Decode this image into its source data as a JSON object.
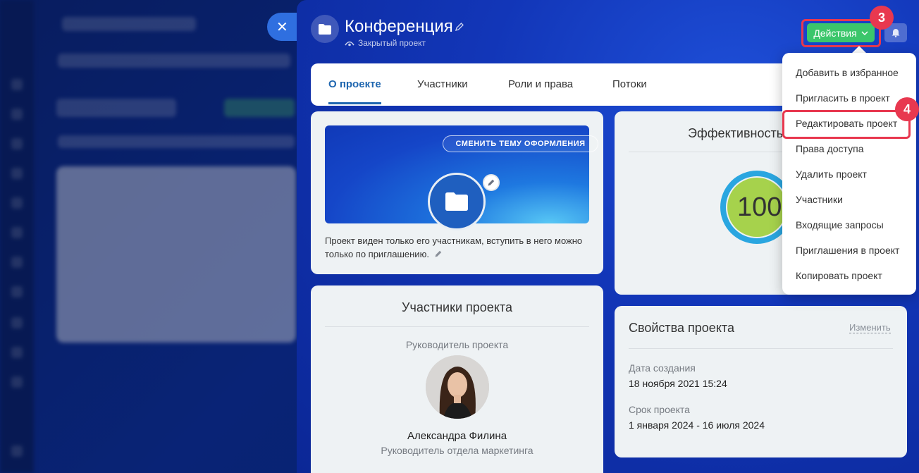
{
  "header": {
    "title": "Конференция",
    "subtitle": "Закрытый проект",
    "actions_label": "Действия",
    "close_symbol": "✕"
  },
  "tabs": [
    {
      "label": "О проекте",
      "active": true
    },
    {
      "label": "Участники",
      "active": false
    },
    {
      "label": "Роли и права",
      "active": false
    },
    {
      "label": "Потоки",
      "active": false
    }
  ],
  "about": {
    "theme_button": "СМЕНИТЬ ТЕМУ ОФОРМЛЕНИЯ",
    "description": "Проект виден только его участникам, вступить в него можно только по приглашению."
  },
  "efficiency": {
    "title": "Эффективность",
    "value": "100%"
  },
  "members": {
    "title": "Участники проекта",
    "role_label": "Руководитель проекта",
    "person_name": "Александра Филина",
    "person_position": "Руководитель отдела маркетинга"
  },
  "properties": {
    "title": "Свойства проекта",
    "edit_link": "Изменить",
    "created_label": "Дата создания",
    "created_value": "18 ноября 2021 15:24",
    "term_label": "Срок проекта",
    "term_value": "1 января 2024 - 16 июля 2024"
  },
  "menu": {
    "items": [
      "Добавить в избранное",
      "Пригласить в проект",
      "Редактировать проект",
      "Права доступа",
      "Удалить проект",
      "Участники",
      "Входящие запросы",
      "Приглашения в проект",
      "Копировать проект"
    ]
  },
  "badges": {
    "actions_step": "3",
    "edit_step": "4"
  },
  "colors": {
    "actions_green": "#3bc66b",
    "highlight_red": "#e8384f",
    "active_tab_blue": "#2067b0",
    "efficiency_ring": "#2aa6e0",
    "efficiency_fill": "#a6d24c"
  },
  "icons": [
    "folder-icon",
    "pencil-icon",
    "eye-icon",
    "chevron-down-icon",
    "bell-icon",
    "close-icon"
  ]
}
